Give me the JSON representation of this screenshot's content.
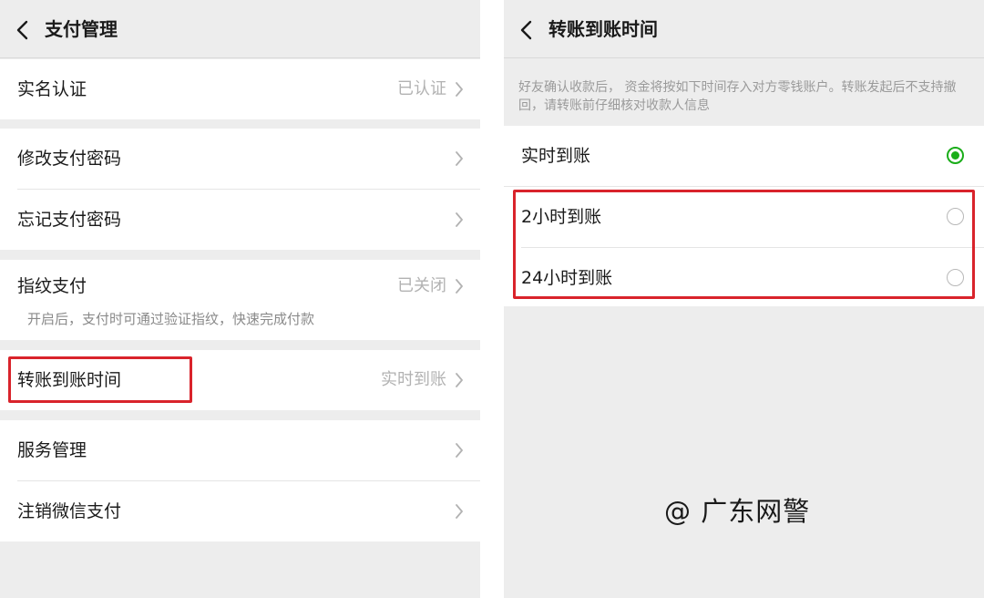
{
  "payment_management": {
    "title": "支付管理",
    "items": [
      {
        "label": "实名认证",
        "value": "已认证"
      },
      {
        "label": "修改支付密码",
        "value": ""
      },
      {
        "label": "忘记支付密码",
        "value": ""
      },
      {
        "label": "指纹支付",
        "value": "已关闭",
        "hint": "开启后，支付时可通过验证指纹，快速完成付款"
      },
      {
        "label": "转账到账时间",
        "value": "实时到账"
      },
      {
        "label": "服务管理",
        "value": ""
      },
      {
        "label": "注销微信支付",
        "value": ""
      }
    ]
  },
  "transfer_time": {
    "title": "转账到账时间",
    "description": "好友确认收款后， 资金将按如下时间存入对方零钱账户。转账发起后不支持撤回，请转账前仔细核对收款人信息",
    "options": [
      {
        "label": "实时到账",
        "selected": true
      },
      {
        "label": "2小时到账",
        "selected": false
      },
      {
        "label": "24小时到账",
        "selected": false
      }
    ]
  },
  "watermark": "@ 广东网警",
  "colors": {
    "accent_green": "#1aad19",
    "highlight_red": "#d9232b",
    "background": "#ededed"
  }
}
